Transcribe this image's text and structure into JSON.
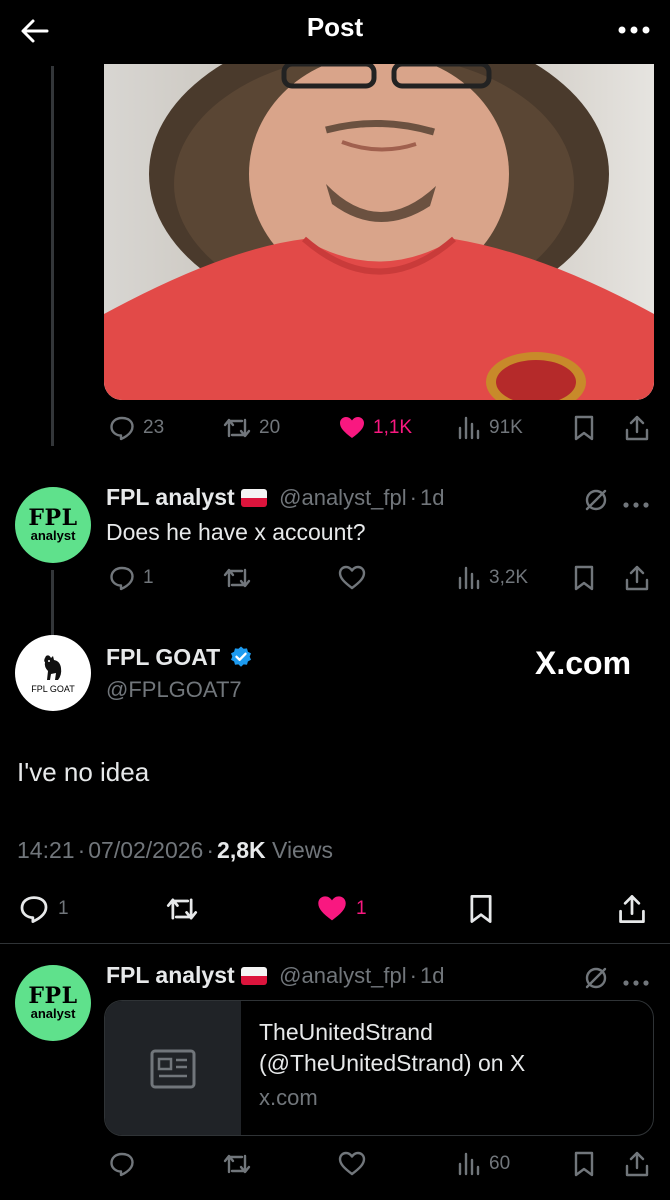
{
  "header": {
    "title": "Post"
  },
  "photo_post": {
    "actions": {
      "replies": "23",
      "reposts": "20",
      "likes": "1,1K",
      "views": "91K"
    }
  },
  "reply1": {
    "avatar": {
      "line1": "FPL",
      "line2": "analyst"
    },
    "name": "FPL analyst",
    "handle": "@analyst_fpl",
    "separator": "·",
    "time": "1d",
    "text": "Does he have x account?",
    "actions": {
      "replies": "1",
      "views": "3,2K"
    }
  },
  "main_post": {
    "avatar_label": "FPL GOAT",
    "name": "FPL GOAT",
    "handle": "@FPLGOAT7",
    "logo_text": "X.com",
    "text": "I've no idea",
    "time": "14:21",
    "separator1": "·",
    "date": "07/02/2026",
    "separator2": "·",
    "views_count": "2,8K",
    "views_label": "Views",
    "actions": {
      "replies": "1",
      "likes": "1"
    }
  },
  "reply2": {
    "avatar": {
      "line1": "FPL",
      "line2": "analyst"
    },
    "name": "FPL analyst",
    "handle": "@analyst_fpl",
    "separator": "·",
    "time": "1d",
    "card": {
      "title": "TheUnitedStrand (@TheUnitedStrand) on X",
      "domain": "x.com"
    },
    "actions": {
      "views": "60"
    }
  },
  "colors": {
    "background": "#000000",
    "text": "#e7e9ea",
    "muted": "#71767b",
    "like_pink": "#f91880",
    "verified_blue": "#1d9bf0",
    "avatar_green": "#5fe18c"
  }
}
